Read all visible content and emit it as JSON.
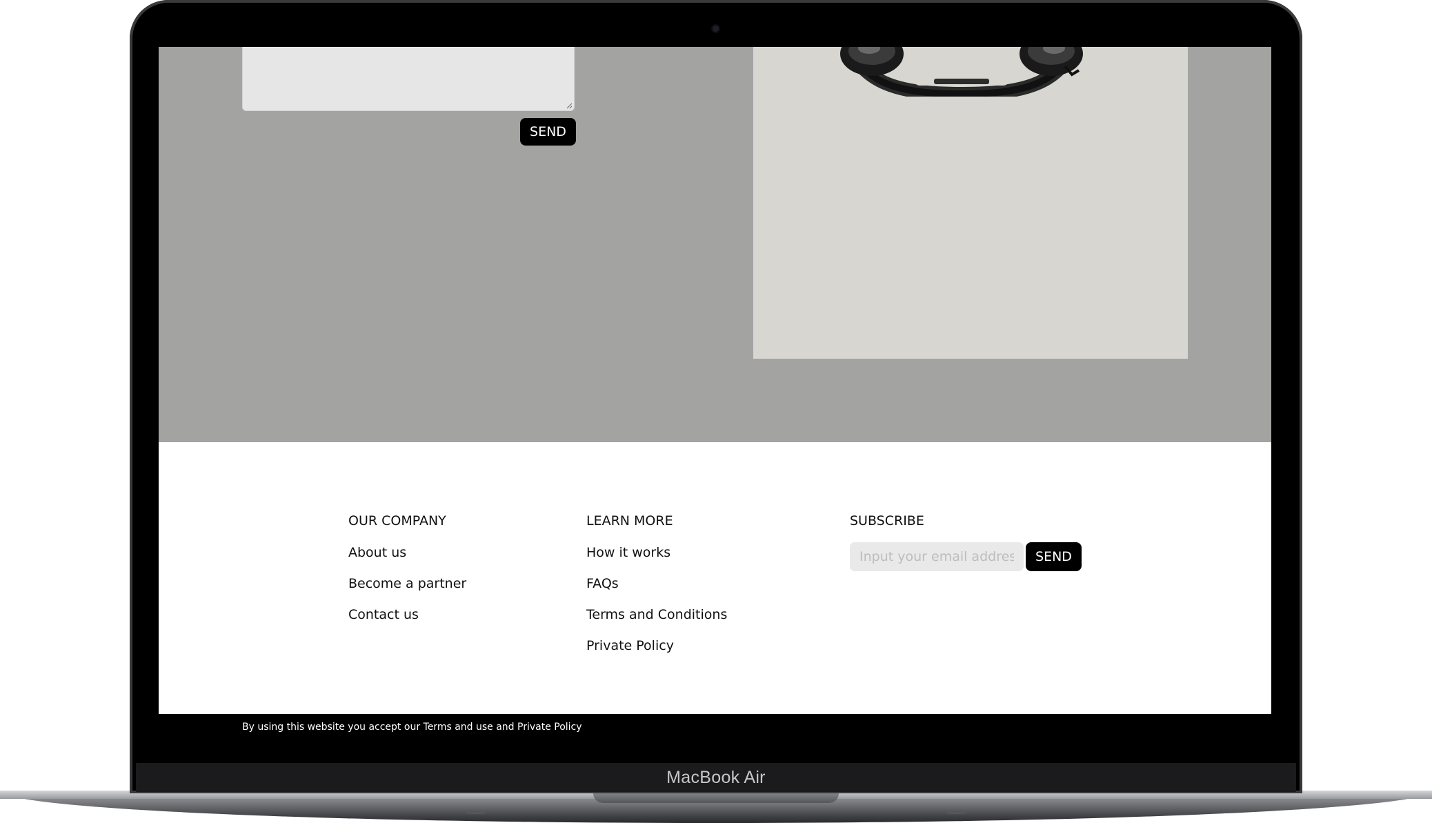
{
  "device": {
    "model_label": "MacBook Air"
  },
  "contact_form": {
    "message_value": "",
    "send_label": "SEND"
  },
  "footer": {
    "our_company": {
      "heading": "OUR COMPANY",
      "links": [
        "About us",
        "Become a partner",
        "Contact us"
      ]
    },
    "learn_more": {
      "heading": "LEARN MORE",
      "links": [
        "How it works",
        "FAQs",
        "Terms and Conditions",
        "Private Policy"
      ]
    },
    "subscribe": {
      "heading": "SUBSCRIBE",
      "email_placeholder": "Input your email address",
      "email_value": "",
      "send_label": "SEND"
    }
  },
  "legal": {
    "text": "By using this website you accept our Terms and use and Private Policy"
  },
  "colors": {
    "contact_background": "#a3a3a2",
    "product_panel": "#d7d6d1",
    "button": "#000000",
    "legal_bar": "#000000"
  }
}
